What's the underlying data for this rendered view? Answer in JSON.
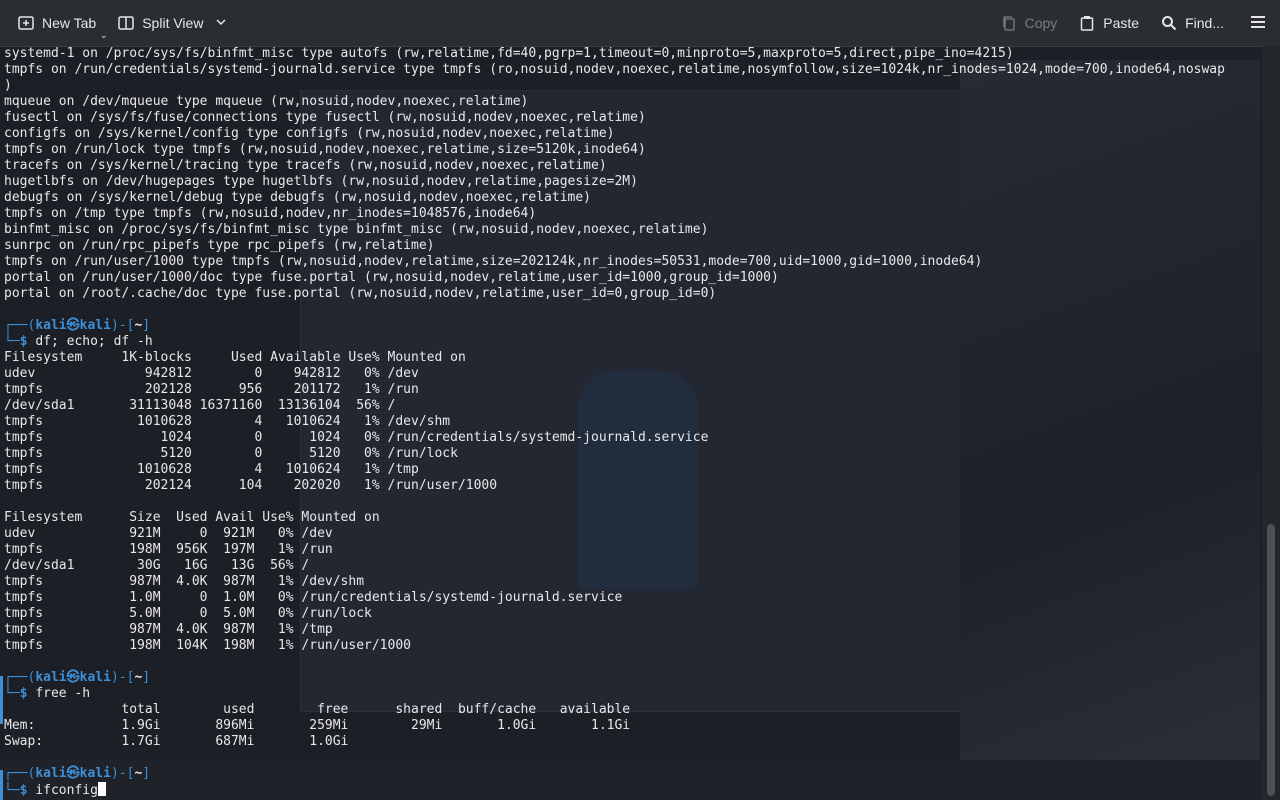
{
  "toolbar": {
    "new_tab": "New Tab",
    "split_view": "Split View",
    "copy": "Copy",
    "paste": "Paste",
    "find": "Find..."
  },
  "prompt": {
    "user": "kali",
    "host": "kali",
    "cwd": "~"
  },
  "mount_lines": [
    "systemd-1 on /proc/sys/fs/binfmt_misc type autofs (rw,relatime,fd=40,pgrp=1,timeout=0,minproto=5,maxproto=5,direct,pipe_ino=4215)",
    "tmpfs on /run/credentials/systemd-journald.service type tmpfs (ro,nosuid,nodev,noexec,relatime,nosymfollow,size=1024k,nr_inodes=1024,mode=700,inode64,noswap",
    ")",
    "mqueue on /dev/mqueue type mqueue (rw,nosuid,nodev,noexec,relatime)",
    "fusectl on /sys/fs/fuse/connections type fusectl (rw,nosuid,nodev,noexec,relatime)",
    "configfs on /sys/kernel/config type configfs (rw,nosuid,nodev,noexec,relatime)",
    "tmpfs on /run/lock type tmpfs (rw,nosuid,nodev,noexec,relatime,size=5120k,inode64)",
    "tracefs on /sys/kernel/tracing type tracefs (rw,nosuid,nodev,noexec,relatime)",
    "hugetlbfs on /dev/hugepages type hugetlbfs (rw,nosuid,nodev,relatime,pagesize=2M)",
    "debugfs on /sys/kernel/debug type debugfs (rw,nosuid,nodev,noexec,relatime)",
    "tmpfs on /tmp type tmpfs (rw,nosuid,nodev,nr_inodes=1048576,inode64)",
    "binfmt_misc on /proc/sys/fs/binfmt_misc type binfmt_misc (rw,nosuid,nodev,noexec,relatime)",
    "sunrpc on /run/rpc_pipefs type rpc_pipefs (rw,relatime)",
    "tmpfs on /run/user/1000 type tmpfs (rw,nosuid,nodev,relatime,size=202124k,nr_inodes=50531,mode=700,uid=1000,gid=1000,inode64)",
    "portal on /run/user/1000/doc type fuse.portal (rw,nosuid,nodev,relatime,user_id=1000,group_id=1000)",
    "portal on /root/.cache/doc type fuse.portal (rw,nosuid,nodev,relatime,user_id=0,group_id=0)"
  ],
  "cmd1": "df; echo; df -h",
  "df_lines": [
    "Filesystem     1K-blocks     Used Available Use% Mounted on",
    "udev              942812        0    942812   0% /dev",
    "tmpfs             202128      956    201172   1% /run",
    "/dev/sda1       31113048 16371160  13136104  56% /",
    "tmpfs            1010628        4   1010624   1% /dev/shm",
    "tmpfs               1024        0      1024   0% /run/credentials/systemd-journald.service",
    "tmpfs               5120        0      5120   0% /run/lock",
    "tmpfs            1010628        4   1010624   1% /tmp",
    "tmpfs             202124      104    202020   1% /run/user/1000"
  ],
  "dfh_lines": [
    "Filesystem      Size  Used Avail Use% Mounted on",
    "udev            921M     0  921M   0% /dev",
    "tmpfs           198M  956K  197M   1% /run",
    "/dev/sda1        30G   16G   13G  56% /",
    "tmpfs           987M  4.0K  987M   1% /dev/shm",
    "tmpfs           1.0M     0  1.0M   0% /run/credentials/systemd-journald.service",
    "tmpfs           5.0M     0  5.0M   0% /run/lock",
    "tmpfs           987M  4.0K  987M   1% /tmp",
    "tmpfs           198M  104K  198M   1% /run/user/1000"
  ],
  "cmd2": "free -h",
  "free_lines": [
    "               total        used        free      shared  buff/cache   available",
    "Mem:           1.9Gi       896Mi       259Mi        29Mi       1.0Gi       1.1Gi",
    "Swap:          1.7Gi       687Mi       1.0Gi"
  ],
  "cmd3": "ifconfig",
  "colors": {
    "accent": "#3d8fd6",
    "background": "#1c1f26",
    "text": "#e8e8e8"
  }
}
